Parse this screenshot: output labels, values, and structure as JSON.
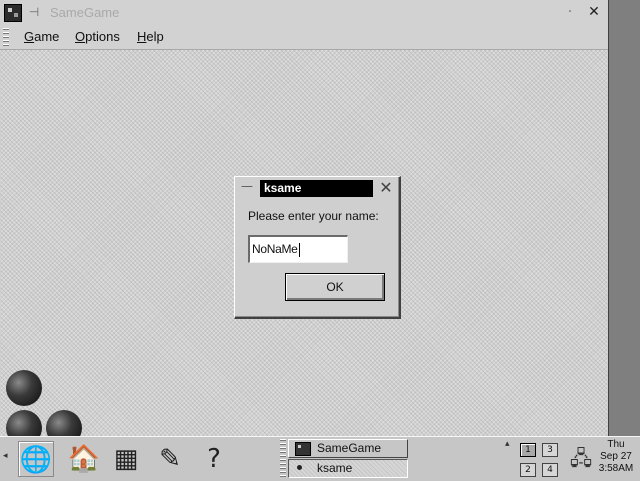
{
  "window": {
    "title": "SameGame",
    "app_icon": "samegame-icon",
    "pin_icon": "pin-icon",
    "minimize_glyph": "·",
    "close_glyph": "✕"
  },
  "menubar": {
    "items": [
      "Game",
      "Options",
      "Help"
    ]
  },
  "dialog": {
    "title": "ksame",
    "menu_glyph": "—",
    "close_glyph": "✕",
    "prompt": "Please enter your name:",
    "name_value": "NoNaMe",
    "ok_label": "OK"
  },
  "taskbar": {
    "arrow_glyph": "◂",
    "launchers": [
      {
        "icon": "globe-icon",
        "glyph": "🌐"
      },
      {
        "icon": "home-folder-icon",
        "glyph": "🏠"
      },
      {
        "icon": "terminal-icon",
        "glyph": "▦"
      },
      {
        "icon": "editor-pen-icon",
        "glyph": "✎"
      },
      {
        "icon": "help-icon",
        "glyph": "?"
      }
    ],
    "tasks": [
      {
        "label": "SameGame"
      },
      {
        "label": "ksame"
      }
    ],
    "pager_arrow": "▴",
    "desktops": [
      "1",
      "2",
      "3",
      "4"
    ],
    "tray_glyph": "🖧",
    "clock": {
      "day": "Thu",
      "date": "Sep 27",
      "time": "3:58AM"
    }
  },
  "colors": {
    "title_active_bg": "#000000",
    "window_bg": "#cfcfcf",
    "taskbar_bg": "#c6c6c6"
  }
}
